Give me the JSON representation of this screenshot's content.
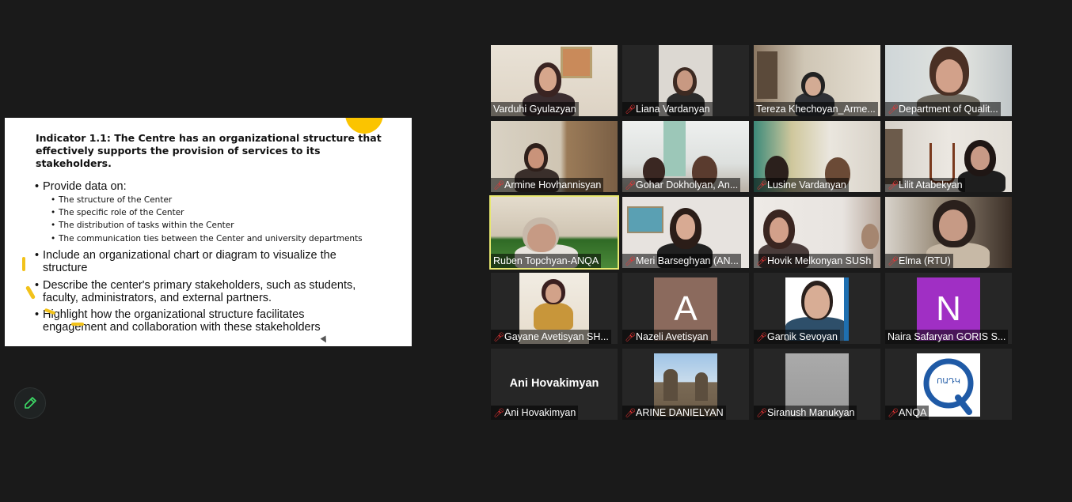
{
  "slide": {
    "title": "Indicator 1.1: The Centre has an organizational structure that effectively supports the provision of services to its stakeholders.",
    "bullets": [
      "Provide data on:",
      "Include an organizational chart or diagram to visualize the structure",
      "Describe the center's primary stakeholders, such as students, faculty, administrators, and external partners.",
      "Highlight how the organizational structure facilitates engagement and collaboration with these stakeholders"
    ],
    "subbullets": [
      "The structure of the Center",
      "The specific role of the Center",
      "The distribution of tasks within the Center",
      "The communication ties between the Center and university departments"
    ]
  },
  "participants": [
    {
      "name": "Varduhi Gyulazyan",
      "muted": false
    },
    {
      "name": "Liana Vardanyan",
      "muted": true
    },
    {
      "name": "Tereza Khechoyan_Arme...",
      "muted": false
    },
    {
      "name": "Department of Qualit...",
      "muted": true
    },
    {
      "name": "Armine Hovhannisyan",
      "muted": true
    },
    {
      "name": "Gohar Dokholyan, An...",
      "muted": true
    },
    {
      "name": "Lusine Vardanyan",
      "muted": true
    },
    {
      "name": "Lilit Atabekyan",
      "muted": true
    },
    {
      "name": "Ruben Topchyan-ANQA",
      "muted": false,
      "active_speaker": true
    },
    {
      "name": "Meri Barseghyan (AN...",
      "muted": true
    },
    {
      "name": "Hovik Melkonyan SUSh",
      "muted": true
    },
    {
      "name": "Elma (RTU)",
      "muted": true
    },
    {
      "name": "Gayane Avetisyan SH...",
      "muted": true
    },
    {
      "name": "Nazeli Avetisyan",
      "muted": true,
      "initial": "A"
    },
    {
      "name": "Garnik Sevoyan",
      "muted": true
    },
    {
      "name": "Naira Safaryan GORIS S...",
      "muted": false,
      "initial": "N"
    },
    {
      "name": "Ani Hovakimyan",
      "muted": true,
      "display_name": "Ani Hovakimyan"
    },
    {
      "name": "ARINE DANIELYAN",
      "muted": true
    },
    {
      "name": "Siranush Manukyan",
      "muted": true
    },
    {
      "name": "ANQA",
      "muted": true,
      "logo_text": "ՈԱԴԿ"
    }
  ],
  "colors": {
    "background": "#1a1a1a",
    "muted_mic": "#e33333",
    "active_speaker_border": "#e8e870",
    "highlighter": "#f2c21a",
    "initial_A_bg": "#8b6a5d",
    "initial_N_bg": "#a02fc4",
    "pen_icon": "#3ddc67"
  },
  "icons": {
    "muted": "muted-mic-icon",
    "annotate": "pencil-icon"
  }
}
